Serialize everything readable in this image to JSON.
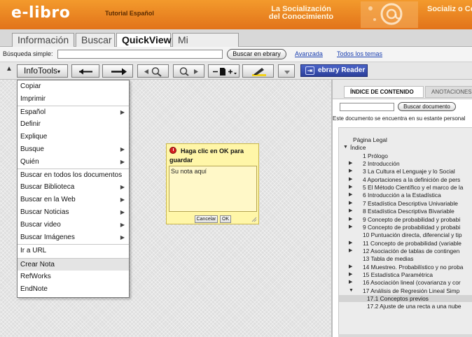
{
  "header": {
    "logo": "e-libro",
    "subtitle": "Tutorial Español",
    "slogan": "La Socialización del Conocimiento",
    "slogan_pt": "Socializ o Conhe",
    "colors": {
      "orange": "#e98324",
      "reader_blue": "#2f45a8"
    }
  },
  "tabs": [
    {
      "label": "Información"
    },
    {
      "label": "Buscar"
    },
    {
      "label": "QuickView",
      "active": true
    },
    {
      "label": "Mi Estantería"
    }
  ],
  "search": {
    "label": "Búsqueda simple:",
    "value": "",
    "button": "Buscar en ebrary",
    "advanced": "Avanzada",
    "all_topics": "Todos los temas"
  },
  "toolbar": {
    "infotools": "InfoTools",
    "reader": "ebrary Reader",
    "icons": [
      "back-arrow-icon",
      "forward-arrow-icon",
      "zoom-out-icon",
      "zoom-in-icon",
      "add-page-icon",
      "highlighter-icon",
      "dropdown-icon"
    ]
  },
  "menu": {
    "items": [
      {
        "label": "Copiar",
        "submenu": false
      },
      {
        "label": "Imprimir",
        "submenu": false
      },
      {
        "label": "Español",
        "submenu": true,
        "separator": true
      },
      {
        "label": "Definir",
        "submenu": false
      },
      {
        "label": "Explique",
        "submenu": false
      },
      {
        "label": "Busque",
        "submenu": true
      },
      {
        "label": "Quién",
        "submenu": true
      },
      {
        "label": "Buscar en todos los documentos",
        "submenu": false,
        "separator": true
      },
      {
        "label": "Buscar Biblioteca",
        "submenu": true
      },
      {
        "label": "Buscar en la Web",
        "submenu": true
      },
      {
        "label": "Buscar Noticias",
        "submenu": true
      },
      {
        "label": "Buscar video",
        "submenu": true
      },
      {
        "label": "Buscar Imágenes",
        "submenu": true
      },
      {
        "label": "Ir a URL",
        "submenu": false,
        "separator": true
      },
      {
        "label": "Crear Nota",
        "submenu": false,
        "separator": true,
        "highlighted": true
      },
      {
        "label": "RefWorks",
        "submenu": false
      },
      {
        "label": "EndNote",
        "submenu": false
      }
    ]
  },
  "note": {
    "message": "Haga clic en OK para guardar",
    "text": "Su nota aquí",
    "cancel": "Cancelar",
    "ok": "OK"
  },
  "panel": {
    "tabs": [
      "ÍNDICE DE CONTENIDO",
      "ANOTACIONES"
    ],
    "search_button": "Buscar documento",
    "shelf_status": "Este documento se encuentra en su estante personal",
    "toc": [
      {
        "label": "Página Legal",
        "level": 0,
        "icon": "none"
      },
      {
        "label": "Índice",
        "level": 0,
        "icon": "expanded"
      },
      {
        "label": "1 Prólogo",
        "level": 1,
        "icon": "none"
      },
      {
        "label": "2 Introducción",
        "level": 1,
        "icon": "collapsed"
      },
      {
        "label": "3 La Cultura el Lenguaje y lo Social",
        "level": 1,
        "icon": "collapsed"
      },
      {
        "label": "4 Aportaciones a la definición de pers",
        "level": 1,
        "icon": "collapsed"
      },
      {
        "label": "5 El Método Científico y el marco de la",
        "level": 1,
        "icon": "collapsed"
      },
      {
        "label": "6 Introducción a la Estadística",
        "level": 1,
        "icon": "collapsed"
      },
      {
        "label": "7 Estadística Descriptiva Univariable",
        "level": 1,
        "icon": "collapsed"
      },
      {
        "label": "8 Estadística Descriptiva Bivariable",
        "level": 1,
        "icon": "collapsed"
      },
      {
        "label": "9 Concepto de probabilidad y probabi",
        "level": 1,
        "icon": "collapsed"
      },
      {
        "label": "9 Concepto de probabilidad y probabi",
        "level": 1,
        "icon": "collapsed"
      },
      {
        "label": "10 Puntuación directa, diferencial y tip",
        "level": 1,
        "icon": "none"
      },
      {
        "label": "11 Concepto de probabilidad (variable",
        "level": 1,
        "icon": "collapsed"
      },
      {
        "label": "12 Asociación de tablas de contingen",
        "level": 1,
        "icon": "collapsed"
      },
      {
        "label": "13 Tabla de medias",
        "level": 1,
        "icon": "none"
      },
      {
        "label": "14 Muestreo. Probabilístico y no proba",
        "level": 1,
        "icon": "collapsed"
      },
      {
        "label": "15 Estadística Paramétrica",
        "level": 1,
        "icon": "collapsed"
      },
      {
        "label": "16 Asociación lineal (covarianza y cor",
        "level": 1,
        "icon": "collapsed"
      },
      {
        "label": "17 Análisis de Regresión Lineal Simp",
        "level": 1,
        "icon": "expanded"
      },
      {
        "label": "17.1 Conceptos previos",
        "level": 2,
        "icon": "none",
        "selected": true
      },
      {
        "label": "17.2 Ajuste de una recta a una nube",
        "level": 2,
        "icon": "none"
      }
    ]
  }
}
